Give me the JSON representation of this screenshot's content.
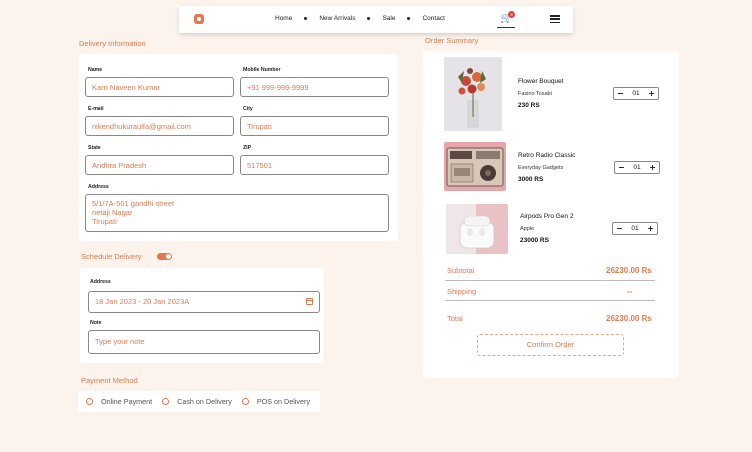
{
  "nav": {
    "links": [
      "Home",
      "New Arrivals",
      "Sale",
      "Contact"
    ],
    "cart_count": "4"
  },
  "delivery": {
    "title": "Delivery Information",
    "name_label": "Name",
    "name_value": "Karri Naveen Kumar",
    "mobile_label": "Mobile Number",
    "mobile_value": "+91 999-999-9999",
    "email_label": "E-mail",
    "email_value": "nikendhukuraulfa@gmail.com",
    "city_label": "City",
    "city_value": "Tirupati",
    "state_label": "State",
    "state_value": "Andhra Pradesh",
    "zip_label": "ZIP",
    "zip_value": "517501",
    "address_label": "Address",
    "address_lines": [
      "5/1/7A-501 gandhi street",
      "netaji Nagar",
      "Tirupati"
    ]
  },
  "schedule": {
    "title": "Schedule Delivery",
    "toggle_on": true,
    "address_label": "Address",
    "date_value": "18 Jan 2023 - 20 Jan 2023A",
    "note_label": "Note",
    "note_placeholder": "Type your note"
  },
  "payment": {
    "title": "Payment Method",
    "options": [
      "Online Payment",
      "Cash on Delivery",
      "POS on Delivery"
    ]
  },
  "summary": {
    "title": "Order Summary",
    "items": [
      {
        "name": "Flower Bouquet",
        "brand": "Fasino Tosabi",
        "price": "230 RS",
        "qty": "01"
      },
      {
        "name": "Retro Radio Classic",
        "brand": "Everyday Gadgets",
        "price": "3000 RS",
        "qty": "01"
      },
      {
        "name": "Airpods Pro Gen 2",
        "brand": "Apple",
        "price": "23000 RS",
        "qty": "01"
      }
    ],
    "subtotal_label": "Subtotal",
    "subtotal_value": "26230.00 Rs",
    "shipping_label": "Shipping",
    "shipping_value": "--",
    "total_label": "Total",
    "total_value": "26230.00 Rs",
    "confirm_label": "Confirm Order"
  },
  "colors": {
    "accent": "#e07a4f",
    "background": "#fcf4ec"
  }
}
